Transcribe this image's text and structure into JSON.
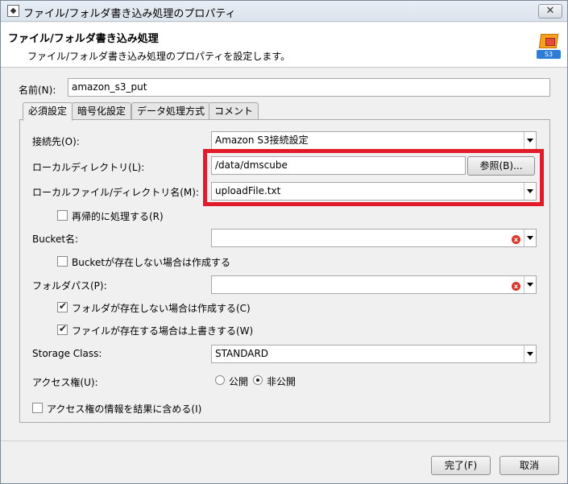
{
  "window": {
    "title": "ファイル/フォルダ書き込み処理のプロパティ"
  },
  "header": {
    "title": "ファイル/フォルダ書き込み処理",
    "description": "ファイル/フォルダ書き込み処理のプロパティを設定します。",
    "icon_badge": "S3"
  },
  "name_field": {
    "label": "名前(N):",
    "value": "amazon_s3_put"
  },
  "tabs": [
    {
      "label": "必須設定",
      "active": true
    },
    {
      "label": "暗号化設定",
      "active": false
    },
    {
      "label": "データ処理方式",
      "active": false
    },
    {
      "label": "コメント",
      "active": false
    }
  ],
  "form": {
    "connection": {
      "label": "接続先(O):",
      "value": "Amazon S3接続設定"
    },
    "local_dir": {
      "label": "ローカルディレクトリ(L):",
      "value": "/data/dmscube",
      "browse_label": "参照(B)..."
    },
    "local_file": {
      "label": "ローカルファイル/ディレクトリ名(M):",
      "value": "uploadFile.txt"
    },
    "recursive": {
      "label": "再帰的に処理する(R)",
      "checked": false
    },
    "bucket": {
      "label": "Bucket名:",
      "value": ""
    },
    "create_bucket": {
      "label": "Bucketが存在しない場合は作成する",
      "checked": false
    },
    "folder_path": {
      "label": "フォルダパス(P):",
      "value": ""
    },
    "create_folder": {
      "label": "フォルダが存在しない場合は作成する(C)",
      "checked": true
    },
    "overwrite": {
      "label": "ファイルが存在する場合は上書きする(W)",
      "checked": true
    },
    "storage_class": {
      "label": "Storage Class:",
      "value": "STANDARD"
    },
    "access": {
      "label": "アクセス権(U):",
      "public_label": "公開",
      "private_label": "非公開",
      "selected": "private"
    },
    "include_access_info": {
      "label": "アクセス権の情報を結果に含める(I)",
      "checked": false
    }
  },
  "footer": {
    "finish_label": "完了(F)",
    "cancel_label": "取消"
  },
  "colors": {
    "highlight": "#e31a2a"
  }
}
